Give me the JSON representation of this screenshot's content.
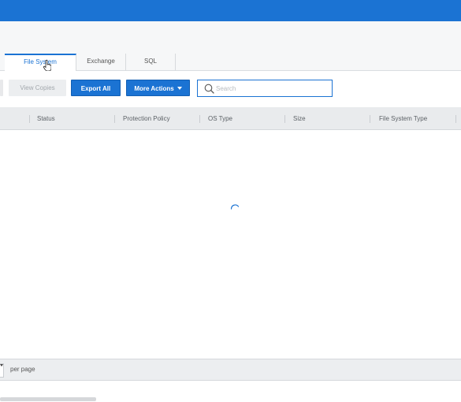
{
  "header": {
    "brand_color": "#1b73d3"
  },
  "tabs": [
    {
      "label": "File System",
      "active": true
    },
    {
      "label": "Exchange",
      "active": false
    },
    {
      "label": "SQL",
      "active": false
    }
  ],
  "toolbar": {
    "view_copies_label": "View Copies",
    "export_all_label": "Export All",
    "more_actions_label": "More Actions"
  },
  "search": {
    "placeholder": "Search",
    "value": ""
  },
  "table": {
    "columns": [
      "Status",
      "Protection Policy",
      "OS Type",
      "Size",
      "File System Type"
    ],
    "rows": [],
    "loading": true
  },
  "pagination": {
    "per_page_label": "per page"
  },
  "icons": {
    "search": "search-icon",
    "spinner": "loading-spinner-icon",
    "cursor": "hand-pointer-cursor",
    "dropdown": "chevron-down-icon"
  }
}
